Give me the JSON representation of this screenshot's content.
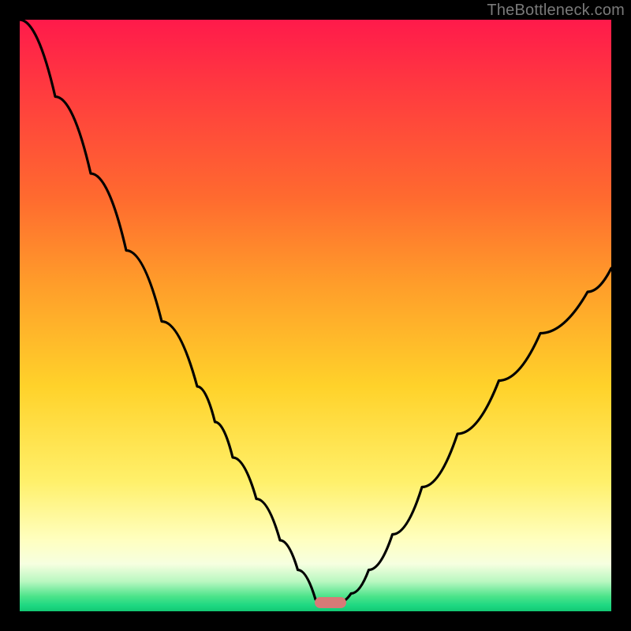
{
  "watermark": "TheBottleneck.com",
  "marker": {
    "color": "#d87a77",
    "x_frac": 0.525,
    "y_frac": 0.985
  },
  "chart_data": {
    "type": "line",
    "title": "",
    "xlabel": "",
    "ylabel": "",
    "xlim": [
      0,
      1
    ],
    "ylim": [
      0,
      1
    ],
    "series": [
      {
        "name": "left-branch",
        "x": [
          0.0,
          0.06,
          0.12,
          0.18,
          0.24,
          0.3,
          0.33,
          0.36,
          0.4,
          0.44,
          0.47,
          0.5,
          0.51
        ],
        "y": [
          1.0,
          0.87,
          0.74,
          0.61,
          0.49,
          0.38,
          0.32,
          0.26,
          0.19,
          0.12,
          0.07,
          0.02,
          0.015
        ]
      },
      {
        "name": "right-branch",
        "x": [
          0.54,
          0.56,
          0.59,
          0.63,
          0.68,
          0.74,
          0.81,
          0.88,
          0.96,
          1.0
        ],
        "y": [
          0.015,
          0.03,
          0.07,
          0.13,
          0.21,
          0.3,
          0.39,
          0.47,
          0.54,
          0.58
        ]
      }
    ],
    "gradient_stops": [
      {
        "pos": 0.0,
        "color": "#ff1a4b"
      },
      {
        "pos": 0.12,
        "color": "#ff3b3f"
      },
      {
        "pos": 0.3,
        "color": "#ff6a2f"
      },
      {
        "pos": 0.45,
        "color": "#ff9e2a"
      },
      {
        "pos": 0.62,
        "color": "#ffd22a"
      },
      {
        "pos": 0.78,
        "color": "#fff06a"
      },
      {
        "pos": 0.88,
        "color": "#ffffc0"
      },
      {
        "pos": 0.92,
        "color": "#f6ffe0"
      },
      {
        "pos": 0.95,
        "color": "#b8f7c0"
      },
      {
        "pos": 0.975,
        "color": "#4be38a"
      },
      {
        "pos": 0.99,
        "color": "#1ed882"
      },
      {
        "pos": 1.0,
        "color": "#13c873"
      }
    ]
  }
}
